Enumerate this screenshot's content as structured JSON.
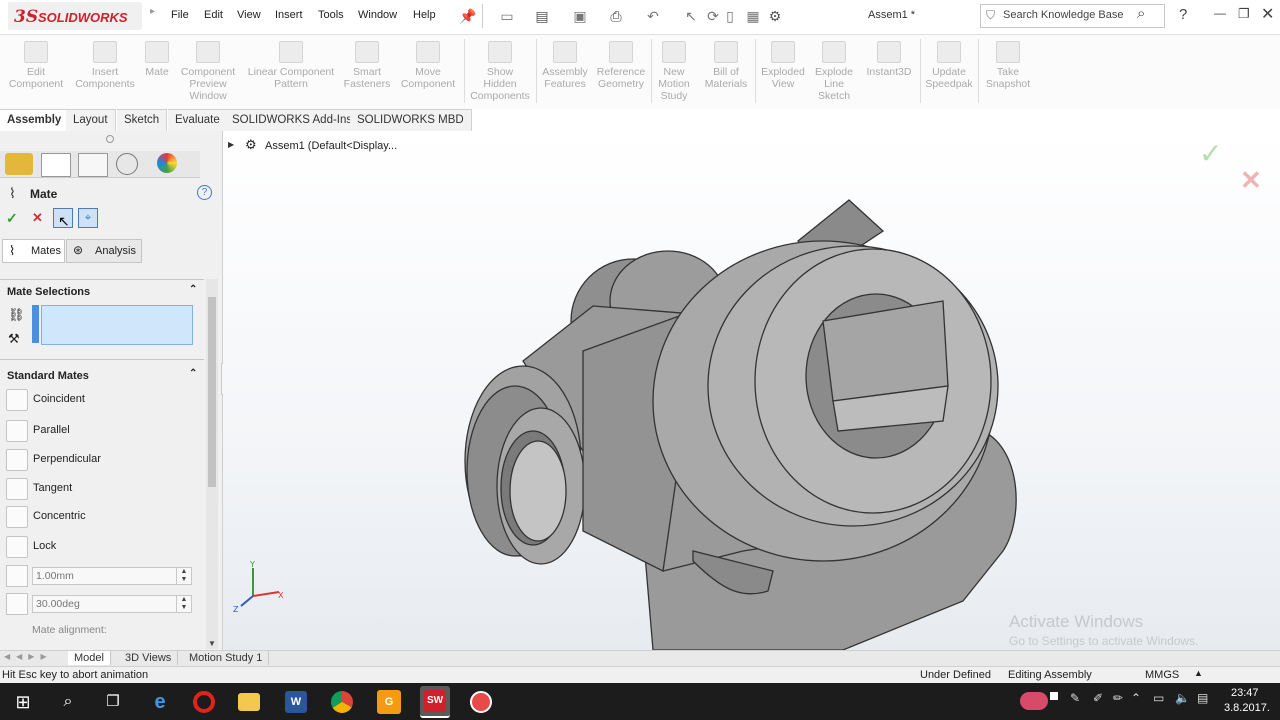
{
  "app": {
    "brand_ds": "3S",
    "brand_name": "SOLIDWORKS",
    "document_title": "Assem1 *"
  },
  "menu": [
    "File",
    "Edit",
    "View",
    "Insert",
    "Tools",
    "Window",
    "Help"
  ],
  "search": {
    "placeholder": "Search Knowledge Base"
  },
  "commands": [
    {
      "label": "Edit\nComponent"
    },
    {
      "label": "Insert\nComponents"
    },
    {
      "label": "Mate"
    },
    {
      "label": "Component\nPreview\nWindow"
    },
    {
      "label": "Linear Component\nPattern"
    },
    {
      "label": "Smart\nFasteners"
    },
    {
      "label": "Move\nComponent"
    },
    {
      "label": "Show\nHidden\nComponents"
    },
    {
      "label": "Assembly\nFeatures"
    },
    {
      "label": "Reference\nGeometry"
    },
    {
      "label": "New\nMotion\nStudy"
    },
    {
      "label": "Bill of\nMaterials"
    },
    {
      "label": "Exploded\nView"
    },
    {
      "label": "Explode\nLine\nSketch"
    },
    {
      "label": "Instant3D"
    },
    {
      "label": "Update\nSpeedpak"
    },
    {
      "label": "Take\nSnapshot"
    }
  ],
  "tabs": [
    "Assembly",
    "Layout",
    "Sketch",
    "Evaluate",
    "SOLIDWORKS Add-Ins",
    "SOLIDWORKS MBD"
  ],
  "panel": {
    "title": "Mate",
    "subtab_mates": "Mates",
    "subtab_analysis": "Analysis",
    "mate_selections": "Mate Selections",
    "standard_mates": "Standard Mates",
    "mates": [
      "Coincident",
      "Parallel",
      "Perpendicular",
      "Tangent",
      "Concentric",
      "Lock"
    ],
    "distance_value": "1.00mm",
    "angle_value": "30.00deg",
    "mate_alignment": "Mate alignment:"
  },
  "tree": {
    "root": "Assem1  (Default<Display..."
  },
  "triad": {
    "x": "X",
    "y": "Y",
    "z": "Z"
  },
  "watermark": {
    "line1": "Activate Windows",
    "line2": "Go to Settings to activate Windows."
  },
  "bottom_tabs": [
    "Model",
    "3D Views",
    "Motion Study 1"
  ],
  "status": {
    "hint": "Hit Esc key to abort animation",
    "state": "Under Defined",
    "mode": "Editing Assembly",
    "units": "MMGS"
  },
  "clock": {
    "time": "23:47",
    "date": "3.8.2017."
  },
  "colors": {
    "accent_red": "#d0202a",
    "selection_blue": "#cfe6fb",
    "taskbar": "#1c1c1c"
  }
}
